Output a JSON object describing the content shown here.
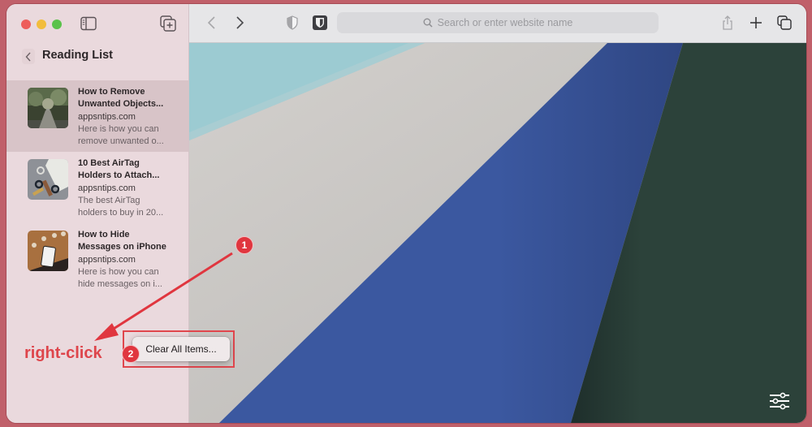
{
  "window": {
    "traffic_lights": [
      "close",
      "minimize",
      "zoom"
    ],
    "sidebar_toggle_icon": "sidebar-icon",
    "new_tab_group_icon": "new-tab-group-icon"
  },
  "sidebar": {
    "back_icon": "chevron-left-icon",
    "title": "Reading List",
    "items": [
      {
        "title_line1": "How to Remove",
        "title_line2": "Unwanted Objects...",
        "domain": "appsntips.com",
        "snippet_line1": "Here is how you can",
        "snippet_line2": "remove unwanted o...",
        "selected": true
      },
      {
        "title_line1": "10 Best AirTag",
        "title_line2": "Holders to Attach...",
        "domain": "appsntips.com",
        "snippet_line1": "The best AirTag",
        "snippet_line2": "holders to buy in 20...",
        "selected": false
      },
      {
        "title_line1": "How to Hide",
        "title_line2": "Messages on iPhone",
        "domain": "appsntips.com",
        "snippet_line1": "Here is how you can",
        "snippet_line2": "hide messages on i...",
        "selected": false
      }
    ]
  },
  "toolbar": {
    "back_icon": "chevron-left-icon",
    "forward_icon": "chevron-right-icon",
    "privacy_icon": "shield-icon",
    "extension_icon": "bitwarden-shield-icon",
    "search_placeholder": "Search or enter website name",
    "share_icon": "share-icon",
    "new_tab_icon": "plus-icon",
    "tab_overview_icon": "tabs-overview-icon"
  },
  "page": {
    "settings_icon": "sliders-icon",
    "colors": {
      "teal": "#9ccbd2",
      "gray": "#c3c1bf",
      "blue": "#3b58a0",
      "dark_green": "#2c423a"
    }
  },
  "context_menu": {
    "items": [
      "Clear All Items..."
    ]
  },
  "annotations": {
    "badge_1": "1",
    "badge_2": "2",
    "label": "right-click",
    "color": "#e0363f"
  }
}
